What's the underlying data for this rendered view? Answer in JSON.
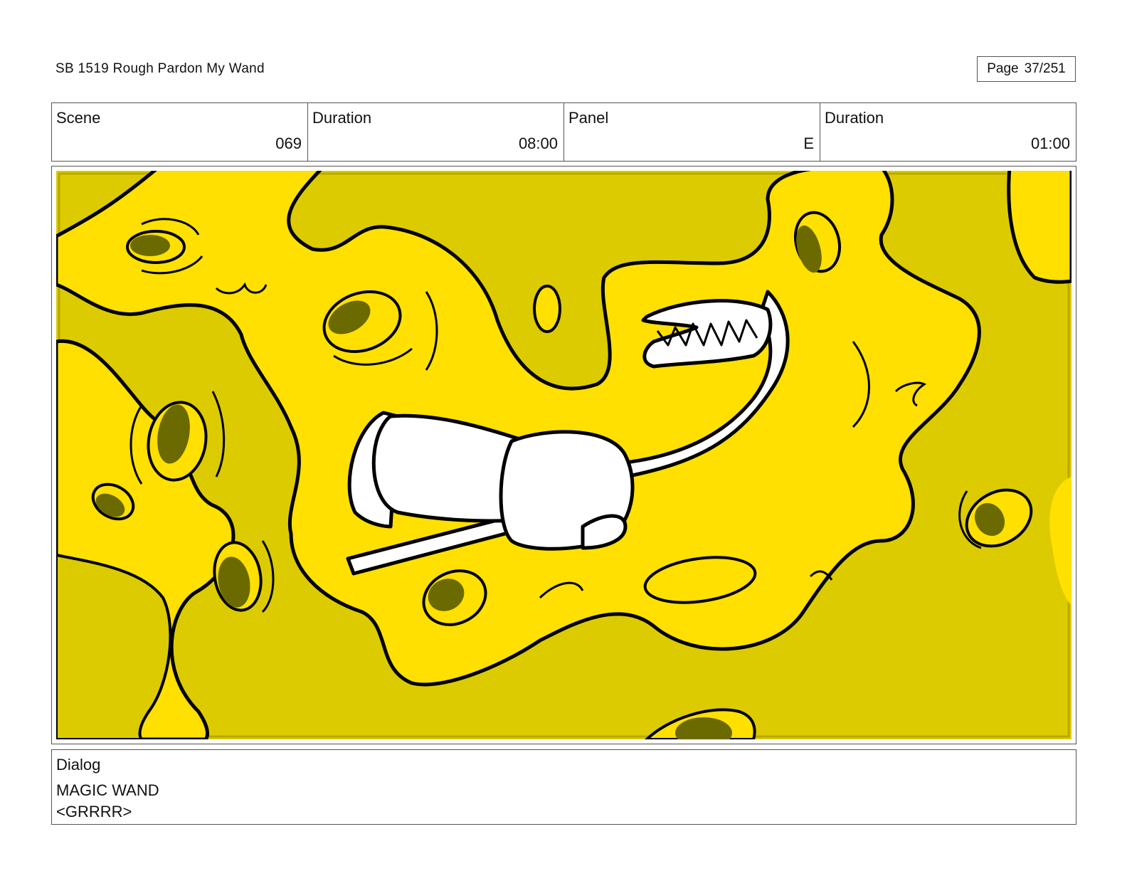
{
  "header": {
    "title": "SB 1519 Rough  Pardon My Wand",
    "page_label": "Page",
    "page_value": "37/251"
  },
  "info": {
    "scene_label": "Scene",
    "scene_value": "069",
    "duration_label": "Duration",
    "duration_value": "08:00",
    "panel_label": "Panel",
    "panel_value": "E",
    "panel_duration_label": "Duration",
    "panel_duration_value": "01:00"
  },
  "colors": {
    "background_yellow": "#dccb00",
    "blob_yellow": "#ffe000",
    "hole_olive": "#6b6a00",
    "ink": "#000000",
    "wand_white": "#ffffff"
  },
  "dialog": {
    "label": "Dialog",
    "character": "MAGIC WAND",
    "line": "<GRRRR>"
  }
}
